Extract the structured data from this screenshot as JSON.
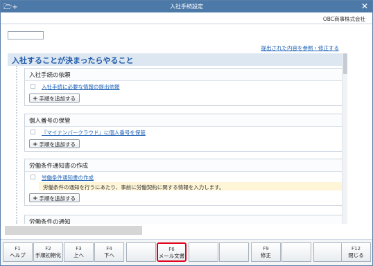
{
  "window": {
    "title": "入社手続設定",
    "app_icon": "🗁+",
    "close": "✕"
  },
  "company": "OBC商事株式会社",
  "reference_link": "提出された内容を参照・修正する",
  "main_heading": "入社することが決まったらやること",
  "sections": [
    {
      "title": "入社手続の依頼",
      "items": [
        {
          "label": "入社手続に必要な情報の提出依頼"
        }
      ],
      "add_label": "手順を追加する"
    },
    {
      "title": "個人番号の保管",
      "items": [
        {
          "label": "『マイナンバークラウド』に個人番号を保管"
        }
      ],
      "add_label": "手順を追加する"
    },
    {
      "title": "労働条件通知書の作成",
      "items": [
        {
          "label": "労働条件通知書の作成",
          "note": "労働条件の通知を行うにあたり、事前に労働契約に関する情報を入力します。"
        }
      ],
      "add_label": "手順を追加する"
    },
    {
      "title": "労働条件の通知"
    }
  ],
  "fkeys": [
    {
      "code": "F1",
      "label": "ヘルプ"
    },
    {
      "code": "F2",
      "label": "手順初期化"
    },
    {
      "code": "F3",
      "label": "上へ"
    },
    {
      "code": "F4",
      "label": "下へ"
    },
    {
      "code": "",
      "label": ""
    },
    {
      "code": "F6",
      "label": "メール文書"
    },
    {
      "code": "",
      "label": ""
    },
    {
      "code": "",
      "label": ""
    },
    {
      "code": "F9",
      "label": "修正"
    },
    {
      "code": "",
      "label": ""
    },
    {
      "code": "",
      "label": ""
    },
    {
      "code": "F12",
      "label": "閉じる"
    }
  ],
  "highlight_color": "#e0001b"
}
